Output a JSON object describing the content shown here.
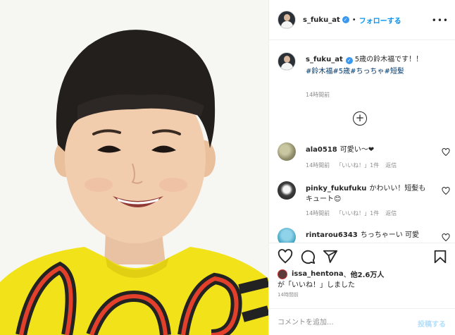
{
  "post": {
    "username": "s_fuku_at",
    "follow_label": "フォローする",
    "separator": "•",
    "more_icon": "more-horizontal-icon",
    "caption_text": "5歳の鈴木福です！！",
    "hashtags": "#鈴木福#5歳#ちっちゃ#短髪",
    "caption_time": "14時間前",
    "load_more_icon": "plus-circle-icon"
  },
  "comments": [
    {
      "user": "ala0518",
      "text": "可愛い〜❤︎",
      "time": "14時間前",
      "likes": "「いいね！」1件",
      "reply": "返信"
    },
    {
      "user": "pinky_fukufuku",
      "text": "かわいい！短髪もキュート😊",
      "time": "14時間前",
      "likes": "「いいね！」1件",
      "reply": "返信"
    },
    {
      "user": "rintarou6343",
      "text": "ちっちゃーい 可愛"
    }
  ],
  "likes": {
    "name": "issa_hentona",
    "connector": "、",
    "others": "他2.6万人",
    "suffix": "が「いいね！」しました"
  },
  "post_time": "14時間前",
  "compose": {
    "placeholder": "コメントを追加...",
    "post_label": "投稿する"
  },
  "colors": {
    "accent": "#0095f6",
    "verified": "#3897f0",
    "hashtag": "#00376b",
    "shirt": "#f2e21a"
  }
}
